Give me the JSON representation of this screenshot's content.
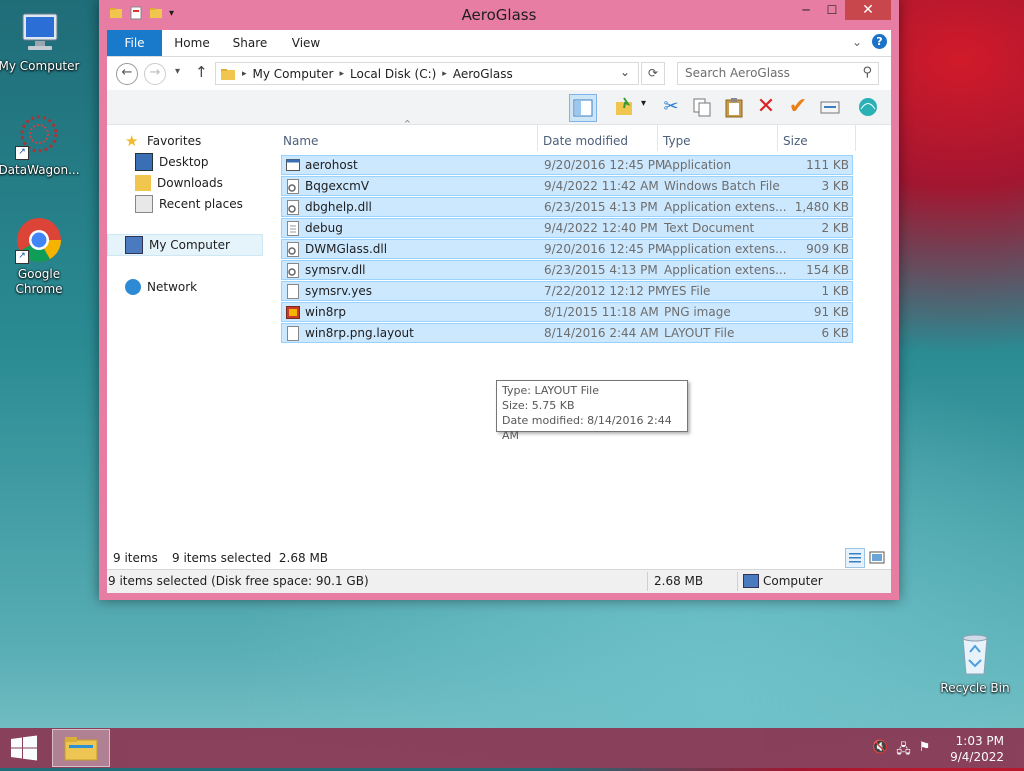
{
  "desktop": {
    "icons": [
      {
        "label": "My Computer"
      },
      {
        "label": "DataWagon..."
      },
      {
        "label": "Google Chrome"
      },
      {
        "label": "Recycle Bin"
      }
    ]
  },
  "window": {
    "title": "AeroGlass",
    "minimize": "─",
    "maximize": "☐",
    "close": "✕"
  },
  "ribbon": {
    "tabs": [
      "File",
      "Home",
      "Share",
      "View"
    ],
    "expand": "⌄",
    "help": "?"
  },
  "nav": {
    "back": "←",
    "forward": "→",
    "recent": "▾",
    "up": "↑",
    "breadcrumb": [
      "My Computer",
      "Local Disk (C:)",
      "AeroGlass"
    ],
    "separator": "▸",
    "dropdown": "⌄",
    "refresh": "⟳",
    "search_placeholder": "Search AeroGlass",
    "search_icon": "⚲"
  },
  "navpane": {
    "items": [
      "Favorites",
      "Desktop",
      "Downloads",
      "Recent places",
      "My Computer",
      "Network"
    ]
  },
  "columns": [
    "Name",
    "Date modified",
    "Type",
    "Size"
  ],
  "files": [
    {
      "name": "aerohost",
      "date": "9/20/2016 12:45 PM",
      "type": "Application",
      "size": "111 KB",
      "icon": "app-icon"
    },
    {
      "name": "BqgexcmV",
      "date": "9/4/2022 11:42 AM",
      "type": "Windows Batch File",
      "size": "3 KB",
      "icon": "gear-file-icon"
    },
    {
      "name": "dbghelp.dll",
      "date": "6/23/2015 4:13 PM",
      "type": "Application extens...",
      "size": "1,480 KB",
      "icon": "gear-file-icon"
    },
    {
      "name": "debug",
      "date": "9/4/2022 12:40 PM",
      "type": "Text Document",
      "size": "2 KB",
      "icon": "text-file-icon"
    },
    {
      "name": "DWMGlass.dll",
      "date": "9/20/2016 12:45 PM",
      "type": "Application extens...",
      "size": "909 KB",
      "icon": "gear-file-icon"
    },
    {
      "name": "symsrv.dll",
      "date": "6/23/2015 4:13 PM",
      "type": "Application extens...",
      "size": "154 KB",
      "icon": "gear-file-icon"
    },
    {
      "name": "symsrv.yes",
      "date": "7/22/2012 12:12 PM",
      "type": "YES File",
      "size": "1 KB",
      "icon": "blank-file-icon"
    },
    {
      "name": "win8rp",
      "date": "8/1/2015 11:18 AM",
      "type": "PNG image",
      "size": "91 KB",
      "icon": "image-file-icon"
    },
    {
      "name": "win8rp.png.layout",
      "date": "8/14/2016 2:44 AM",
      "type": "LAYOUT File",
      "size": "6 KB",
      "icon": "blank-file-icon"
    }
  ],
  "tooltip": {
    "line1": "Type: LAYOUT File",
    "line2": "Size: 5.75 KB",
    "line3": "Date modified: 8/14/2016 2:44 AM"
  },
  "status": {
    "count": "9 items",
    "selected": "9 items selected  2.68 MB",
    "bar_left": "9 items selected (Disk free space: 90.1 GB)",
    "bar_size": "2.68 MB",
    "bar_location": "Computer"
  },
  "taskbar": {
    "time": "1:03 PM",
    "date": "9/4/2022"
  },
  "colors": {
    "window_frame": "#e87da4",
    "selection": "#cce8ff",
    "file_tab": "#1979ca",
    "taskbar": "#8a3b56"
  }
}
